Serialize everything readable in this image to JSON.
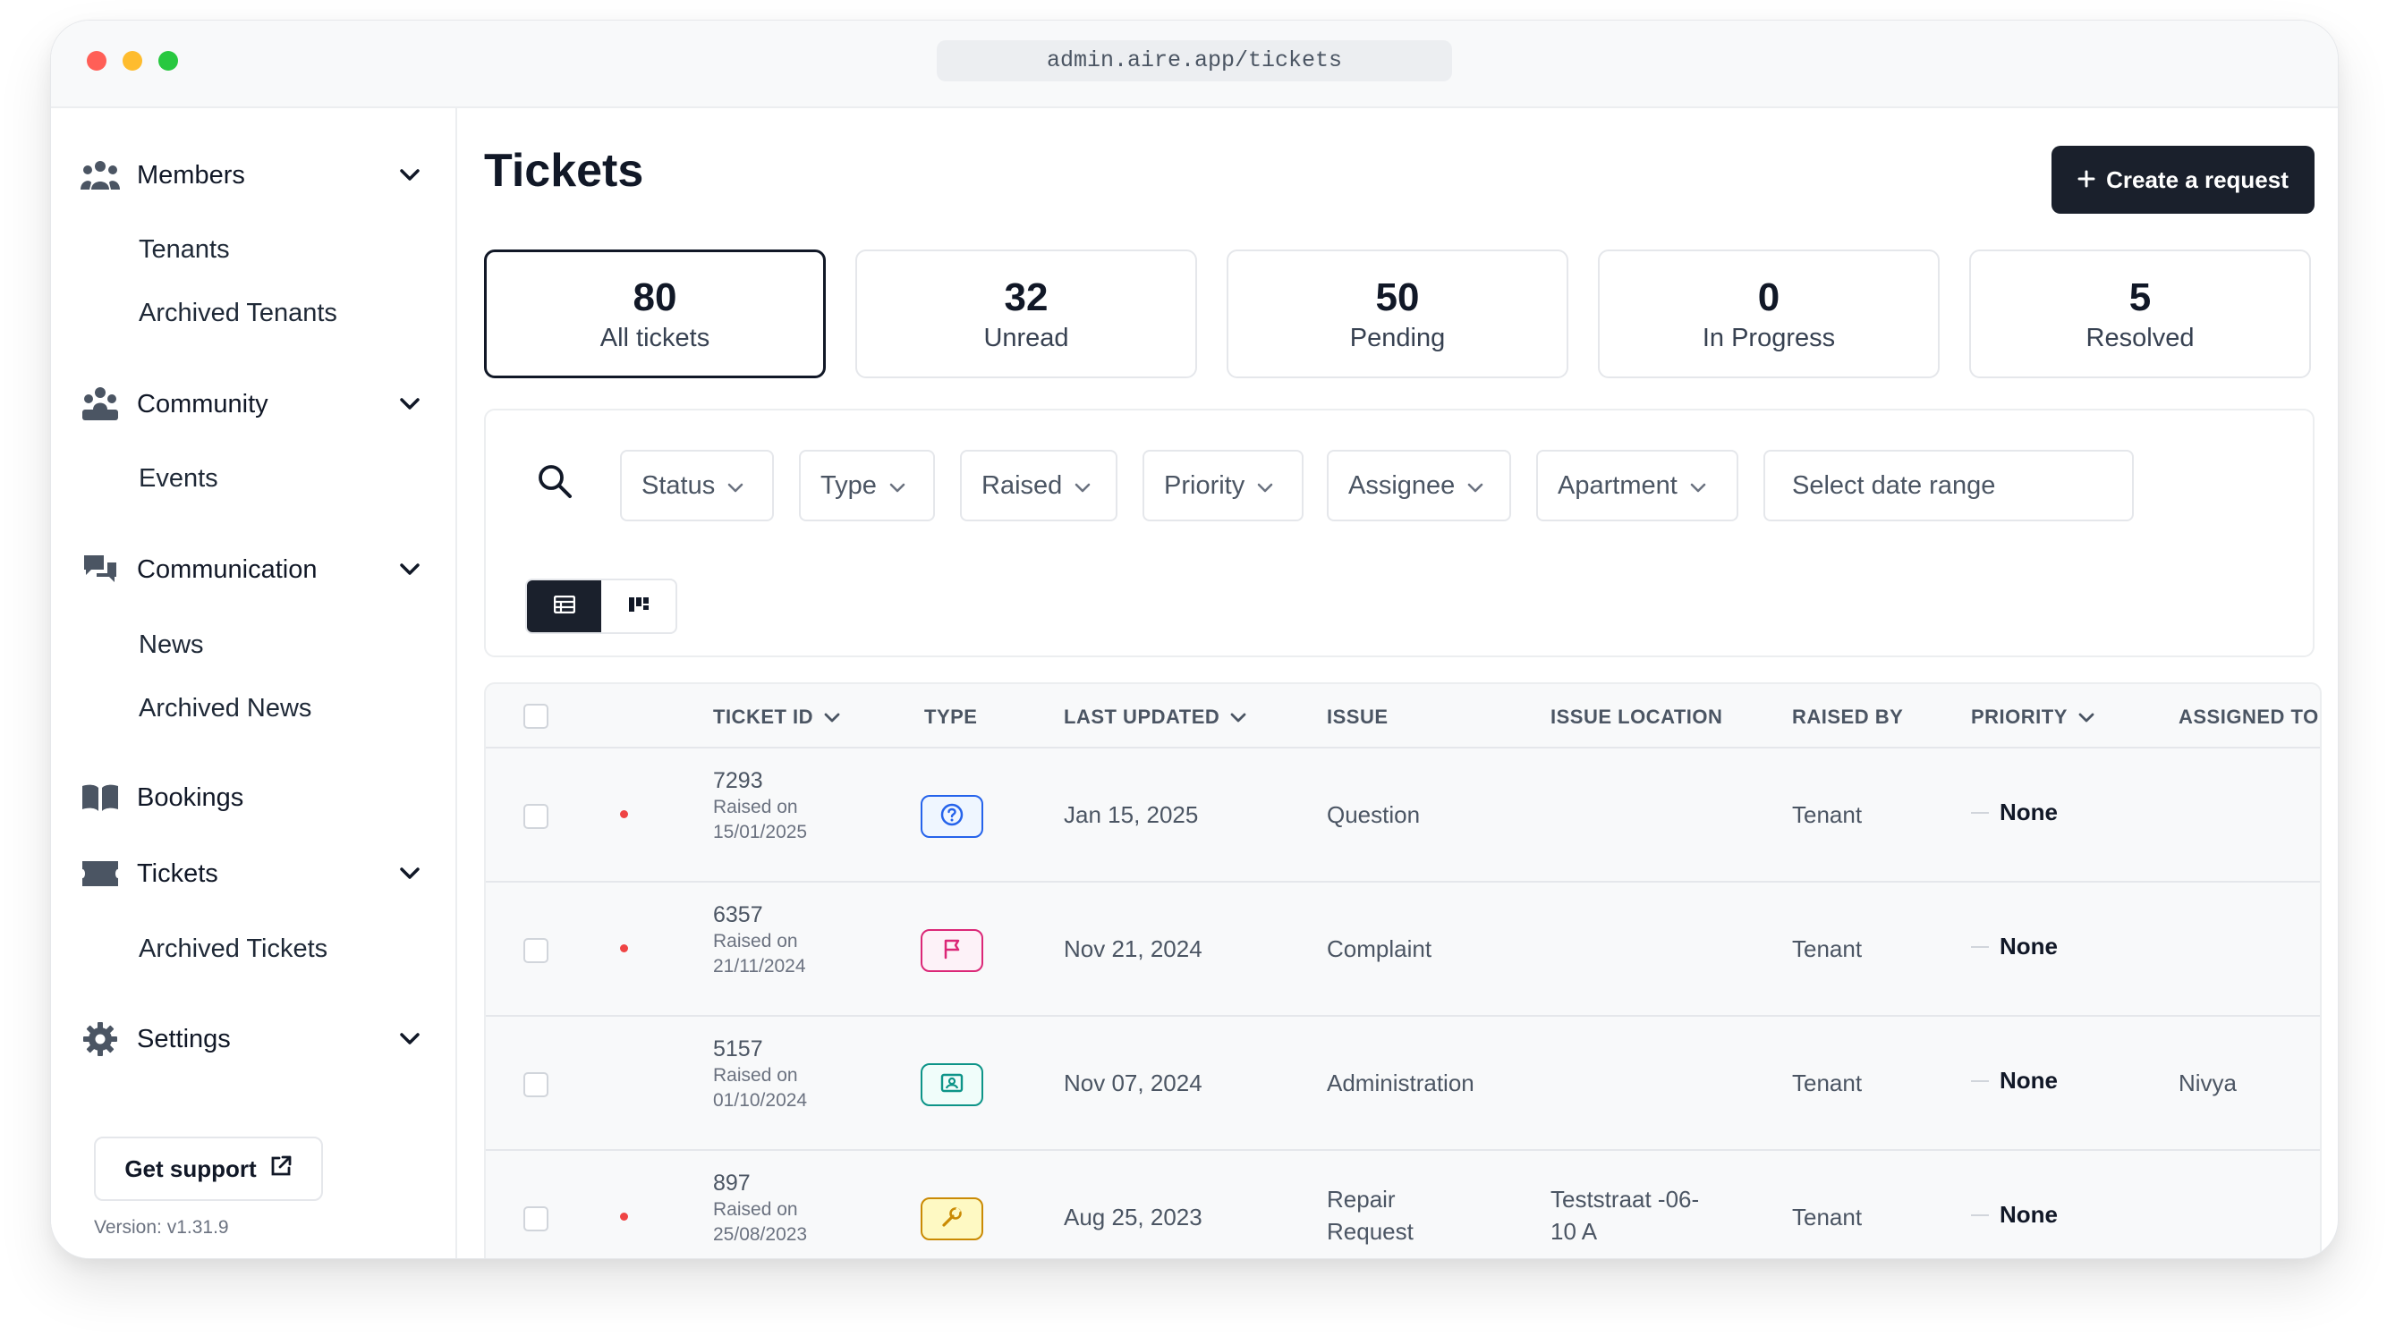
{
  "browser": {
    "url": "admin.aire.app/tickets"
  },
  "sidebar": {
    "groups": [
      {
        "label": "Members",
        "icon": "members-icon",
        "subitems": [
          "Tenants",
          "Archived Tenants"
        ]
      },
      {
        "label": "Community",
        "icon": "community-icon",
        "subitems": [
          "Events"
        ]
      },
      {
        "label": "Communication",
        "icon": "chat-icon",
        "subitems": [
          "News",
          "Archived News"
        ]
      },
      {
        "label": "Bookings",
        "icon": "book-icon",
        "subitems": []
      },
      {
        "label": "Tickets",
        "icon": "ticket-icon",
        "subitems": [
          "Archived Tickets"
        ]
      },
      {
        "label": "Settings",
        "icon": "gear-icon",
        "subitems": []
      }
    ],
    "support_label": "Get support",
    "version": "Version: v1.31.9"
  },
  "page": {
    "title": "Tickets",
    "create_label": "Create a request"
  },
  "stats": [
    {
      "value": "80",
      "label": "All tickets",
      "active": true
    },
    {
      "value": "32",
      "label": "Unread"
    },
    {
      "value": "50",
      "label": "Pending"
    },
    {
      "value": "0",
      "label": "In Progress"
    },
    {
      "value": "5",
      "label": "Resolved"
    }
  ],
  "filters": {
    "buttons": [
      "Status",
      "Type",
      "Raised",
      "Priority",
      "Assignee",
      "Apartment"
    ],
    "date_placeholder": "Select date range"
  },
  "table": {
    "headers": {
      "ticket_id": "TICKET ID",
      "type": "TYPE",
      "last_updated": "LAST UPDATED",
      "issue": "ISSUE",
      "issue_location": "ISSUE LOCATION",
      "raised_by": "RAISED BY",
      "priority": "PRIORITY",
      "assigned_to": "ASSIGNED TO"
    },
    "rows": [
      {
        "id": "7293",
        "raised": "Raised on",
        "raised_date": "15/01/2025",
        "type_icon": "question-icon",
        "type_color": "#2563eb",
        "updated": "Jan 15, 2025",
        "issue": "Question",
        "issue2": "",
        "location": "",
        "location2": "",
        "raised_by": "Tenant",
        "priority": "None",
        "assigned": "",
        "unread": true
      },
      {
        "id": "6357",
        "raised": "Raised on",
        "raised_date": "21/11/2024",
        "type_icon": "flag-icon",
        "type_color": "#db2777",
        "updated": "Nov 21, 2024",
        "issue": "Complaint",
        "issue2": "",
        "location": "",
        "location2": "",
        "raised_by": "Tenant",
        "priority": "None",
        "assigned": "",
        "unread": true
      },
      {
        "id": "5157",
        "raised": "Raised on",
        "raised_date": "01/10/2024",
        "type_icon": "id-card-icon",
        "type_color": "#0d9488",
        "updated": "Nov 07, 2024",
        "issue": "Administration",
        "issue2": "",
        "location": "",
        "location2": "",
        "raised_by": "Tenant",
        "priority": "None",
        "assigned": "Nivya",
        "unread": false
      },
      {
        "id": "897",
        "raised": "Raised on",
        "raised_date": "25/08/2023",
        "type_icon": "wrench-icon",
        "type_color": "#ca8a04",
        "updated": "Aug 25, 2023",
        "issue": "Repair",
        "issue2": "Request",
        "location": "Teststraat -06-",
        "location2": "10 A",
        "raised_by": "Tenant",
        "priority": "None",
        "assigned": "",
        "unread": true
      }
    ]
  }
}
